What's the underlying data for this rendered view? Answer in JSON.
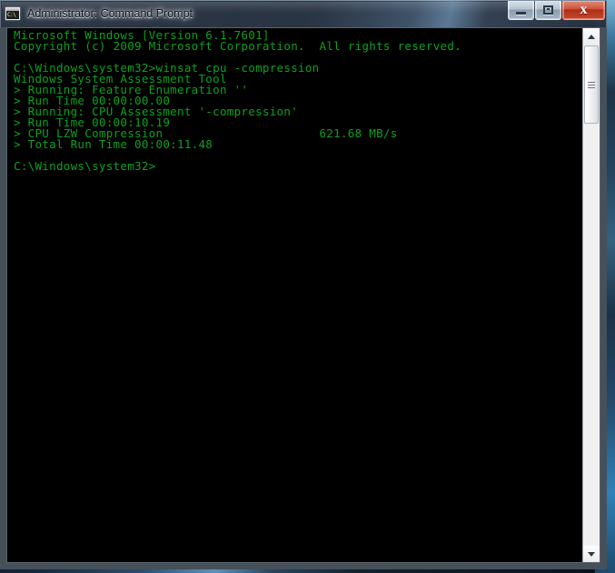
{
  "window": {
    "title": "Administrator: Command Prompt",
    "icon": "console-icon",
    "icon_glyph": "C:\\",
    "controls": {
      "minimize_label": "–",
      "maximize_label": "□",
      "close_label": "x"
    }
  },
  "console": {
    "foreground_color": "#0ca11f",
    "background_color": "#000000",
    "lines": [
      "Microsoft Windows [Version 6.1.7601]",
      "Copyright (c) 2009 Microsoft Corporation.  All rights reserved.",
      "",
      "C:\\Windows\\system32>winsat cpu -compression",
      "Windows System Assessment Tool",
      "> Running: Feature Enumeration ''",
      "> Run Time 00:00:00.00",
      "> Running: CPU Assessment '-compression'",
      "> Run Time 00:00:10.19",
      "> CPU LZW Compression                      621.68 MB/s",
      "> Total Run Time 00:00:11.48",
      "",
      "C:\\Windows\\system32>"
    ],
    "command": "winsat cpu -compression",
    "prompt": "C:\\Windows\\system32>",
    "result_metric": "CPU LZW Compression",
    "result_value": "621.68 MB/s",
    "total_run_time": "00:00:11.48"
  },
  "scrollbar": {
    "up_arrow": "scroll-up-arrow",
    "down_arrow": "scroll-down-arrow",
    "thumb": "scroll-thumb"
  }
}
